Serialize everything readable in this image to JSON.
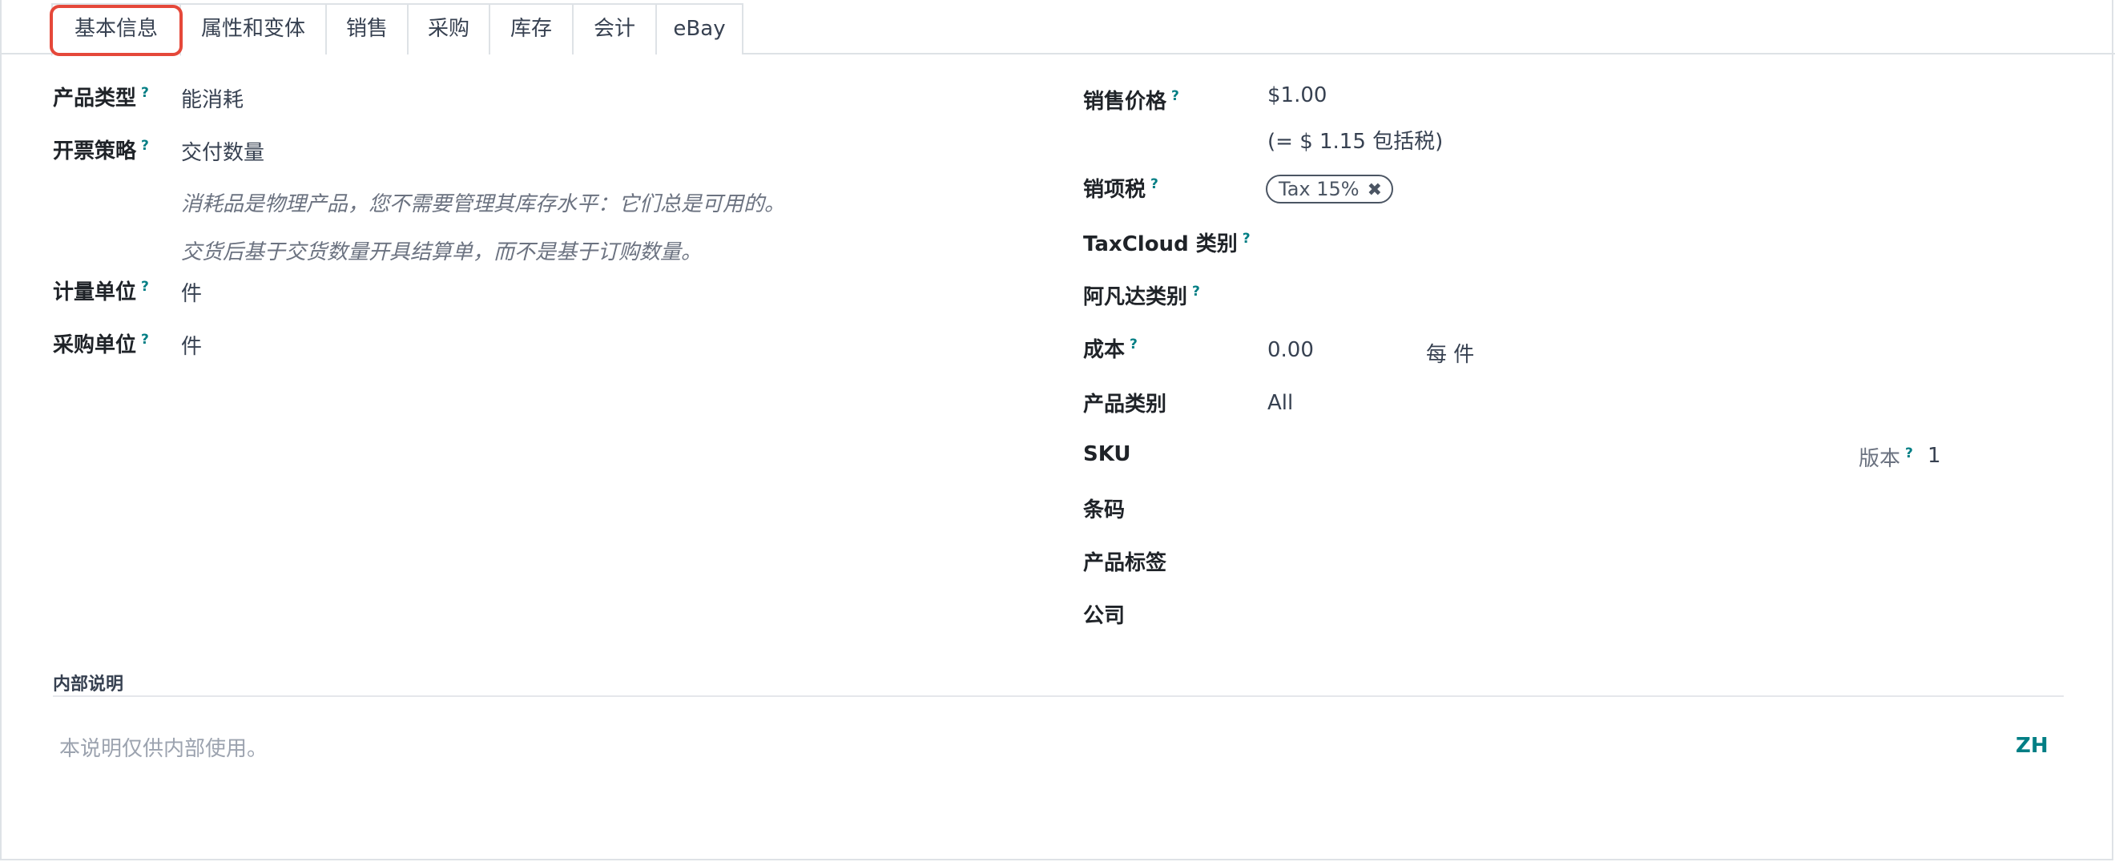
{
  "tabs": [
    {
      "label": "基本信息",
      "active": true
    },
    {
      "label": "属性和变体"
    },
    {
      "label": "销售"
    },
    {
      "label": "采购"
    },
    {
      "label": "库存"
    },
    {
      "label": "会计"
    },
    {
      "label": "eBay"
    }
  ],
  "left": {
    "product_type": {
      "label": "产品类型",
      "value": "能消耗"
    },
    "invoice_policy": {
      "label": "开票策略",
      "value": "交付数量"
    },
    "hint_consumable": "消耗品是物理产品，您不需要管理其库存水平：它们总是可用的。",
    "hint_invoice": "交货后基于交货数量开具结算单，而不是基于订购数量。",
    "uom": {
      "label": "计量单位",
      "value": "件"
    },
    "purchase_uom": {
      "label": "采购单位",
      "value": "件"
    }
  },
  "right": {
    "sales_price": {
      "label": "销售价格",
      "value": "$1.00",
      "tax_included": "(= $ 1.15 包括税)"
    },
    "sales_tax": {
      "label": "销项税",
      "tag": "Tax 15%",
      "remove_icon": "close-icon"
    },
    "taxcloud_category": {
      "label": "TaxCloud 类别"
    },
    "avatax_category": {
      "label": "阿凡达类别"
    },
    "cost": {
      "label": "成本",
      "value": "0.00",
      "per_unit": "每 件"
    },
    "product_category": {
      "label": "产品类别",
      "value": "All"
    },
    "sku": {
      "label": "SKU"
    },
    "version": {
      "label": "版本",
      "value": "1"
    },
    "barcode": {
      "label": "条码"
    },
    "product_tags": {
      "label": "产品标签"
    },
    "company": {
      "label": "公司"
    }
  },
  "internal_notes": {
    "title": "内部说明",
    "placeholder": "本说明仅供内部使用。",
    "lang": "ZH"
  },
  "colors": {
    "accent": "#017e84",
    "highlight": "#e5483a"
  }
}
